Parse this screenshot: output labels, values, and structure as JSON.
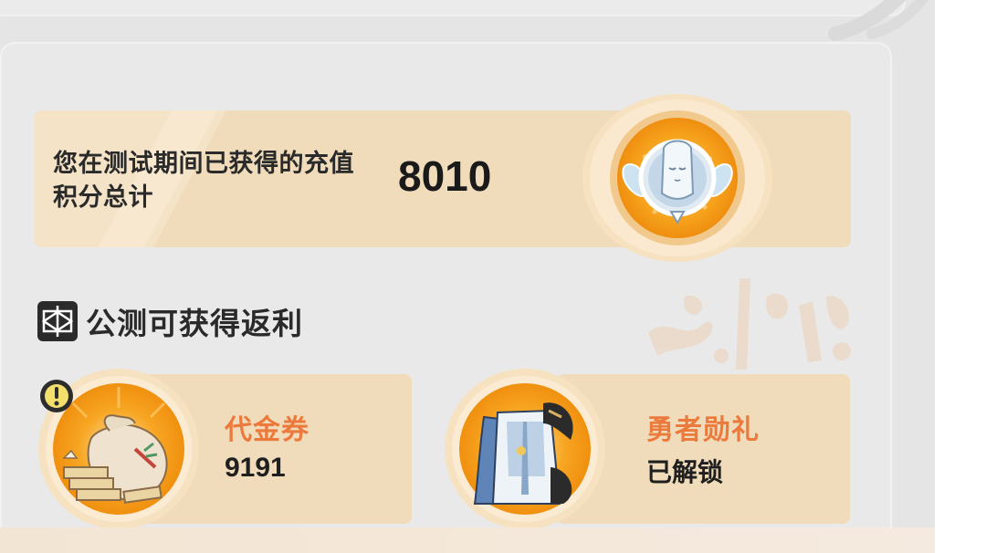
{
  "summary": {
    "label": "您在测试期间已获得的充值积分总计",
    "value": "8010",
    "medal_icon": "goddess-medal-icon"
  },
  "section": {
    "title": "公测可获得返利",
    "icon": "rebate-gift-icon"
  },
  "rewards": [
    {
      "name": "代金券",
      "value": "9191",
      "icon": "money-bag-icon",
      "has_alert": true
    },
    {
      "name": "勇者勋礼",
      "value": "已解锁",
      "icon": "hero-outfit-icon",
      "has_alert": false
    }
  ],
  "colors": {
    "page_bg": "#e5e5e5",
    "card_bg": "#f0dcba",
    "accent_orange": "#ec7a3c",
    "medal_orange": "#f6a21c"
  }
}
